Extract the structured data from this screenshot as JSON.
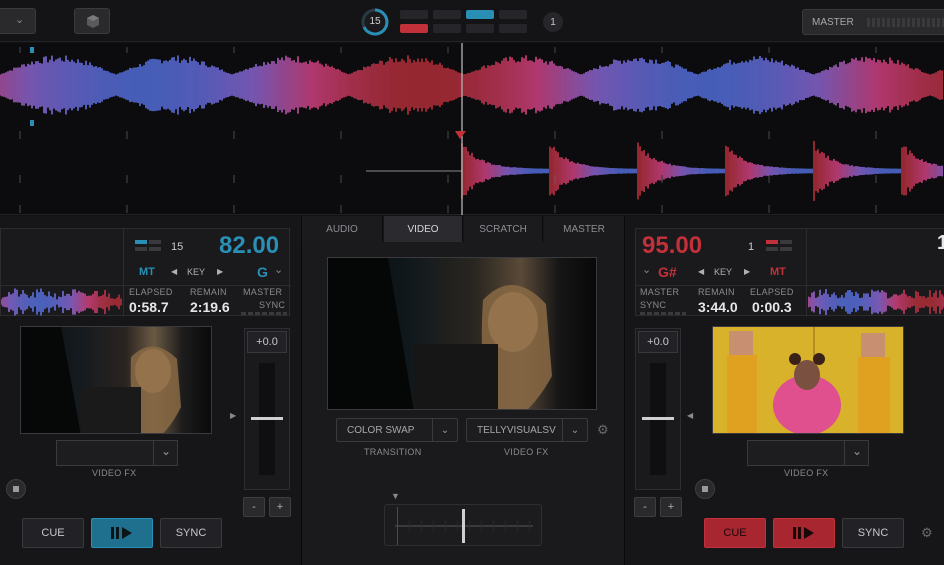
{
  "top": {
    "loop_count": "15",
    "right_number": "1",
    "master_label": "MASTER"
  },
  "colors": {
    "accent_blue": "#2a8fb5",
    "accent_red": "#c2303a",
    "bg": "#121214"
  },
  "left_deck": {
    "bpm": "82.00",
    "loop": "15",
    "mt": "MT",
    "key_label": "KEY",
    "key_value": "G",
    "elapsed_label": "ELAPSED",
    "elapsed": "0:58.7",
    "remain_label": "REMAIN",
    "remain": "2:19.6",
    "master_label": "MASTER",
    "sync_label": "SYNC",
    "pitch": "+0.0",
    "video_fx_label": "VIDEO FX",
    "cue": "CUE",
    "play_icon": "play-pause-icon",
    "sync": "SYNC",
    "minus": "-",
    "plus": "+"
  },
  "center": {
    "tabs": [
      "AUDIO",
      "VIDEO",
      "SCRATCH",
      "MASTER"
    ],
    "active_tab": "VIDEO",
    "transition_value": "COLOR SWAP",
    "transition_label": "TRANSITION",
    "video_fx_value": "TELLYVISUALSV",
    "video_fx_label": "VIDEO FX"
  },
  "right_deck": {
    "bpm": "95.00",
    "key_value": "G#",
    "key_label": "KEY",
    "mt": "MT",
    "loop": "1",
    "master_label": "MASTER",
    "sync_label": "SYNC",
    "remain_label": "REMAIN",
    "remain": "3:44.0",
    "elapsed_label": "ELAPSED",
    "elapsed": "0:00.3",
    "pitch": "+0.0",
    "video_fx_label": "VIDEO FX",
    "cue": "CUE",
    "sync": "SYNC",
    "minus": "-",
    "plus": "+",
    "right_edge_digit": "1"
  }
}
